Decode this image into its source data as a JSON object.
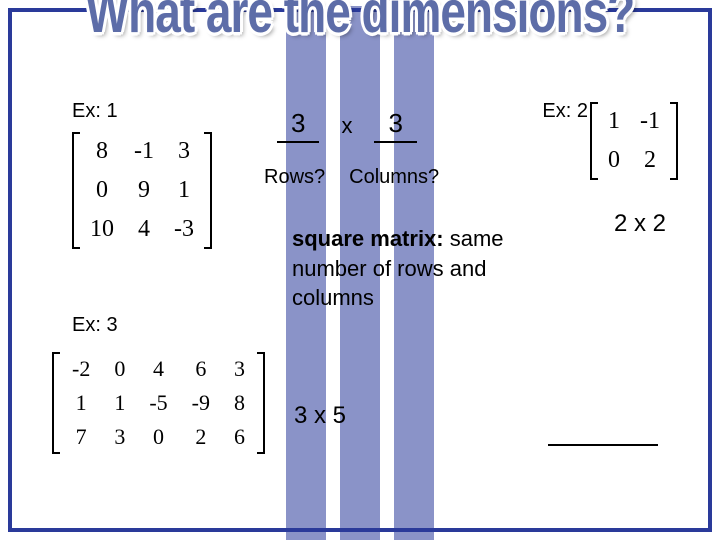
{
  "title": "What are the dimensions?",
  "labels": {
    "ex1": "Ex: 1",
    "ex2": "Ex: 2",
    "ex3": "Ex: 3"
  },
  "dim": {
    "rows": "3",
    "x": "x",
    "cols": "3"
  },
  "rowcol": {
    "rows": "Rows?",
    "cols": "Columns?"
  },
  "sqdef": {
    "term": "square matrix:",
    "rest": " same number of rows and columns"
  },
  "ans2": "2 x 2",
  "ans3": "3 x 5",
  "matrix1": [
    [
      "8",
      "-1",
      "3"
    ],
    [
      "0",
      "9",
      "1"
    ],
    [
      "10",
      "4",
      "-3"
    ]
  ],
  "matrix2": [
    [
      "1",
      "-1"
    ],
    [
      "0",
      "2"
    ]
  ],
  "matrix3": [
    [
      "-2",
      "0",
      "4",
      "6",
      "3"
    ],
    [
      "1",
      "1",
      "-5",
      "-9",
      "8"
    ],
    [
      "7",
      "3",
      "0",
      "2",
      "6"
    ]
  ]
}
